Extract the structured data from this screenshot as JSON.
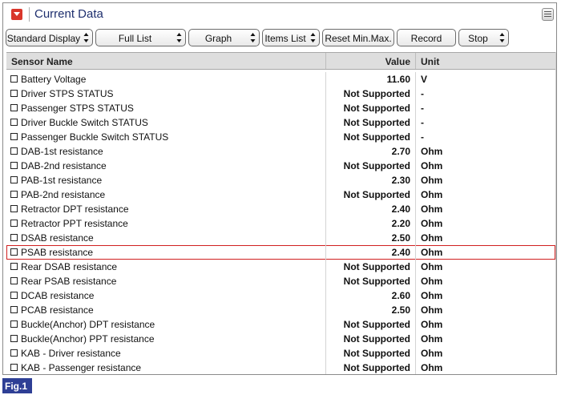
{
  "window": {
    "title": "Current Data"
  },
  "toolbar": {
    "buttons": [
      {
        "label": "Standard Display",
        "has_spinner": true
      },
      {
        "label": "Full List",
        "has_spinner": true
      },
      {
        "label": "Graph",
        "has_spinner": true
      },
      {
        "label": "Items List",
        "has_spinner": true
      },
      {
        "label": "Reset Min.Max.",
        "has_spinner": false
      },
      {
        "label": "Record",
        "has_spinner": false
      },
      {
        "label": "Stop",
        "has_spinner": true
      }
    ]
  },
  "grid": {
    "columns": {
      "name": "Sensor Name",
      "value": "Value",
      "unit": "Unit"
    },
    "selected_row": 12,
    "rows": [
      {
        "name": "Battery Voltage",
        "value": "11.60",
        "unit": "V"
      },
      {
        "name": "Driver STPS STATUS",
        "value": "Not Supported",
        "unit": "-"
      },
      {
        "name": "Passenger STPS STATUS",
        "value": "Not Supported",
        "unit": "-"
      },
      {
        "name": "Driver Buckle Switch STATUS",
        "value": "Not Supported",
        "unit": "-"
      },
      {
        "name": "Passenger Buckle Switch STATUS",
        "value": "Not Supported",
        "unit": "-"
      },
      {
        "name": "DAB-1st resistance",
        "value": "2.70",
        "unit": "Ohm"
      },
      {
        "name": "DAB-2nd resistance",
        "value": "Not Supported",
        "unit": "Ohm"
      },
      {
        "name": "PAB-1st resistance",
        "value": "2.30",
        "unit": "Ohm"
      },
      {
        "name": "PAB-2nd resistance",
        "value": "Not Supported",
        "unit": "Ohm"
      },
      {
        "name": "Retractor DPT resistance",
        "value": "2.40",
        "unit": "Ohm"
      },
      {
        "name": "Retractor PPT resistance",
        "value": "2.20",
        "unit": "Ohm"
      },
      {
        "name": "DSAB resistance",
        "value": "2.50",
        "unit": "Ohm"
      },
      {
        "name": "PSAB resistance",
        "value": "2.40",
        "unit": "Ohm"
      },
      {
        "name": "Rear DSAB resistance",
        "value": "Not Supported",
        "unit": "Ohm"
      },
      {
        "name": "Rear PSAB resistance",
        "value": "Not Supported",
        "unit": "Ohm"
      },
      {
        "name": "DCAB resistance",
        "value": "2.60",
        "unit": "Ohm"
      },
      {
        "name": "PCAB resistance",
        "value": "2.50",
        "unit": "Ohm"
      },
      {
        "name": "Buckle(Anchor) DPT resistance",
        "value": "Not Supported",
        "unit": "Ohm"
      },
      {
        "name": "Buckle(Anchor) PPT resistance",
        "value": "Not Supported",
        "unit": "Ohm"
      },
      {
        "name": "KAB - Driver resistance",
        "value": "Not Supported",
        "unit": "Ohm"
      },
      {
        "name": "KAB - Passenger resistance",
        "value": "Not Supported",
        "unit": "Ohm"
      }
    ]
  },
  "figure": {
    "label": "Fig.1"
  },
  "colors": {
    "title_text": "#1e2f6e",
    "title_icon": "#d9362b",
    "selection_outline": "#d02020",
    "fig_label_bg": "#2e3f95"
  },
  "icons": {
    "title": "collapse-arrow-icon",
    "menu": "menu-list-icon",
    "spinner": "up-down-arrows-icon"
  }
}
